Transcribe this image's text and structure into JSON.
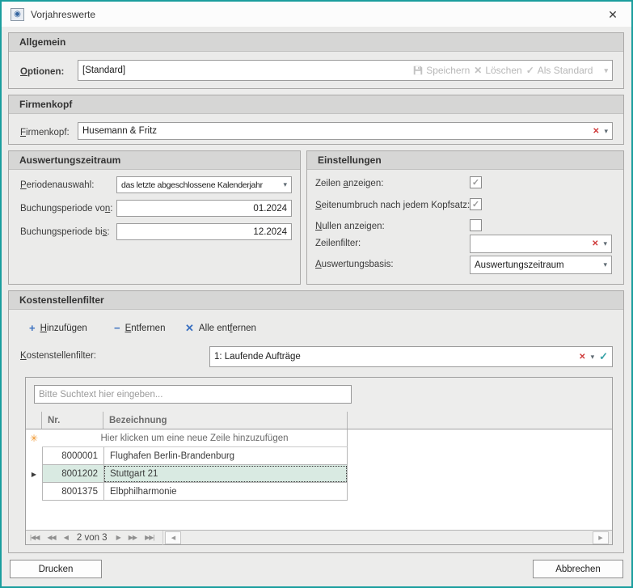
{
  "window": {
    "title": "Vorjahreswerte"
  },
  "colors": {
    "window_border": "#1a9e9e",
    "accent_blue": "#3a70c0",
    "red_x": "#cf3a3a",
    "teal_check": "#39a3a8",
    "selected_row_bg": "#d9eae2",
    "new_row_asterisk": "#f09326",
    "disabled_text": "#b7b7b7"
  },
  "icons": {
    "close": "✕",
    "window_glyph": "◉",
    "dropdown": "▾",
    "red_x": "✕",
    "check": "✓",
    "save": "save-icon",
    "delete_x": "✕",
    "plus": "+",
    "minus": "−",
    "x": "✕",
    "asterisk": "✳",
    "row_arrow": "▶",
    "pager_first": "|◀◀",
    "pager_prev_page": "◀◀",
    "pager_prev": "◀",
    "pager_next": "▶",
    "pager_next_page": "▶▶",
    "pager_last": "▶▶|",
    "scroll_left": "◀",
    "scroll_right": "▶"
  },
  "allgemein": {
    "header": "Allgemein",
    "optionen_label": "Optionen:",
    "optionen_value": "[Standard]",
    "speichern_label": "Speichern",
    "loeschen_label": "Löschen",
    "als_standard_label": "Als Standard"
  },
  "firmenkopf": {
    "header": "Firmenkopf",
    "label": "Firmenkopf:",
    "value": "Husemann & Fritz"
  },
  "zeitraum": {
    "header": "Auswertungszeitraum",
    "periodenauswahl_label": "Periodenauswahl:",
    "periodenauswahl_value": "das letzte abgeschlossene Kalenderjahr",
    "von_label": "Buchungsperiode von:",
    "von_value": "01.2024",
    "bis_label": "Buchungsperiode bis:",
    "bis_value": "12.2024"
  },
  "einstellungen": {
    "header": "Einstellungen",
    "zeilen_label": "Zeilen anzeigen:",
    "zeilen_check": "✓",
    "seitenumbruch_label": "Seitenumbruch nach jedem Kopfsatz:",
    "seitenumbruch_check": "✓",
    "nullen_label": "Nullen anzeigen:",
    "nullen_check": "",
    "zeilenfilter_label": "Zeilenfilter:",
    "zeilenfilter_value": "",
    "auswertungsbasis_label": "Auswertungsbasis:",
    "auswertungsbasis_value": "Auswertungszeitraum"
  },
  "ksf": {
    "header": "Kostenstellenfilter",
    "hinzufuegen_label": "Hinzufügen",
    "entfernen_label": "Entfernen",
    "alle_entfernen_label": "Alle entfernen",
    "label": "Kostenstellenfilter:",
    "value": "1: Laufende Aufträge",
    "search_placeholder": "Bitte Suchtext hier eingeben...",
    "grid": {
      "columns": {
        "nr": "Nr.",
        "bezeichnung": "Bezeichnung"
      },
      "new_row_text": "Hier klicken um eine neue Zeile hinzuzufügen",
      "rows": [
        {
          "nr": "8000001",
          "bezeichnung": "Flughafen Berlin-Brandenburg"
        },
        {
          "nr": "8001202",
          "bezeichnung": "Stuttgart 21"
        },
        {
          "nr": "8001375",
          "bezeichnung": "Elbphilharmonie"
        }
      ],
      "pager_text": "2 von 3"
    }
  },
  "footer": {
    "drucken": "Drucken",
    "abbrechen": "Abbrechen"
  }
}
